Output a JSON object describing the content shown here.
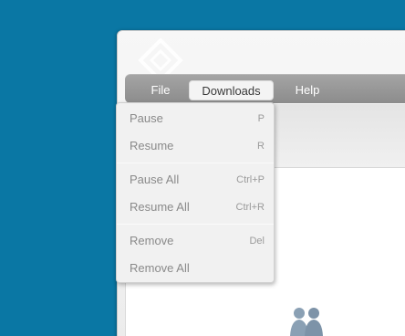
{
  "menubar": {
    "items": [
      {
        "label": "File"
      },
      {
        "label": "Downloads"
      },
      {
        "label": "Help"
      }
    ]
  },
  "dropdown": {
    "items": [
      {
        "label": "Pause",
        "shortcut": "P"
      },
      {
        "label": "Resume",
        "shortcut": "R"
      },
      {
        "label": "Pause All",
        "shortcut": "Ctrl+P"
      },
      {
        "label": "Resume All",
        "shortcut": "Ctrl+R"
      },
      {
        "label": "Remove",
        "shortcut": "Del"
      },
      {
        "label": "Remove All",
        "shortcut": ""
      }
    ]
  },
  "icons": {
    "logo": "diamond-logo-icon",
    "people": "people-silhouette-icon"
  },
  "colors": {
    "desktop_bg": "#0a77a4",
    "menubar_bg": "#9a9a9a",
    "menu_text": "#ffffff",
    "disabled_text": "#8a8a8a"
  }
}
